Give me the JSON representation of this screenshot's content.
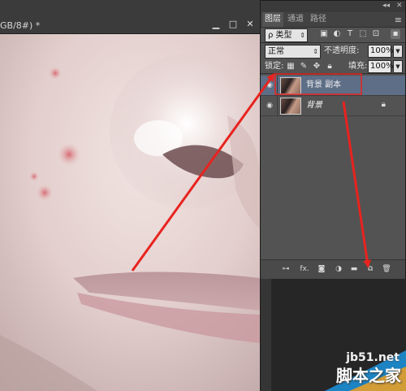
{
  "document": {
    "tab_title": "GB/8#) *",
    "minimize_glyph": "▁",
    "restore_glyph": "□",
    "close_glyph": "✕"
  },
  "layers_panel": {
    "collapse_glyph": "◂◂",
    "close_glyph": "✕",
    "tabs": [
      {
        "label": "图层",
        "active": true
      },
      {
        "label": "通道",
        "active": false
      },
      {
        "label": "路径",
        "active": false
      }
    ],
    "menu_glyph": "≡",
    "filter": {
      "kind_label": "ρ 类型",
      "icons": [
        "image-filter-icon",
        "adjustment-filter-icon",
        "type-filter-icon",
        "shape-filter-icon",
        "smart-object-filter-icon",
        "filter-toggle-icon"
      ]
    },
    "blend_mode": "正常",
    "opacity_label": "不透明度:",
    "opacity_value": "100%",
    "lock_label": "锁定:",
    "fill_label": "填充:",
    "fill_value": "100%",
    "layers": [
      {
        "name": "背景 副本",
        "selected": true,
        "visible": true,
        "locked": false,
        "italic": false
      },
      {
        "name": "背景",
        "selected": false,
        "visible": true,
        "locked": true,
        "italic": true
      }
    ],
    "footer_icons": [
      "link-layers-icon",
      "fx-icon",
      "add-mask-icon",
      "adjustment-layer-icon",
      "new-group-icon",
      "new-layer-icon",
      "delete-layer-icon"
    ],
    "footer_fx": "fx."
  },
  "watermark": {
    "site": "jb51.net",
    "name": "脚本之家"
  },
  "colors": {
    "selected_row": "#5d6e86",
    "annotation_arrow": "#e8231f",
    "panel_bg": "#535353"
  }
}
